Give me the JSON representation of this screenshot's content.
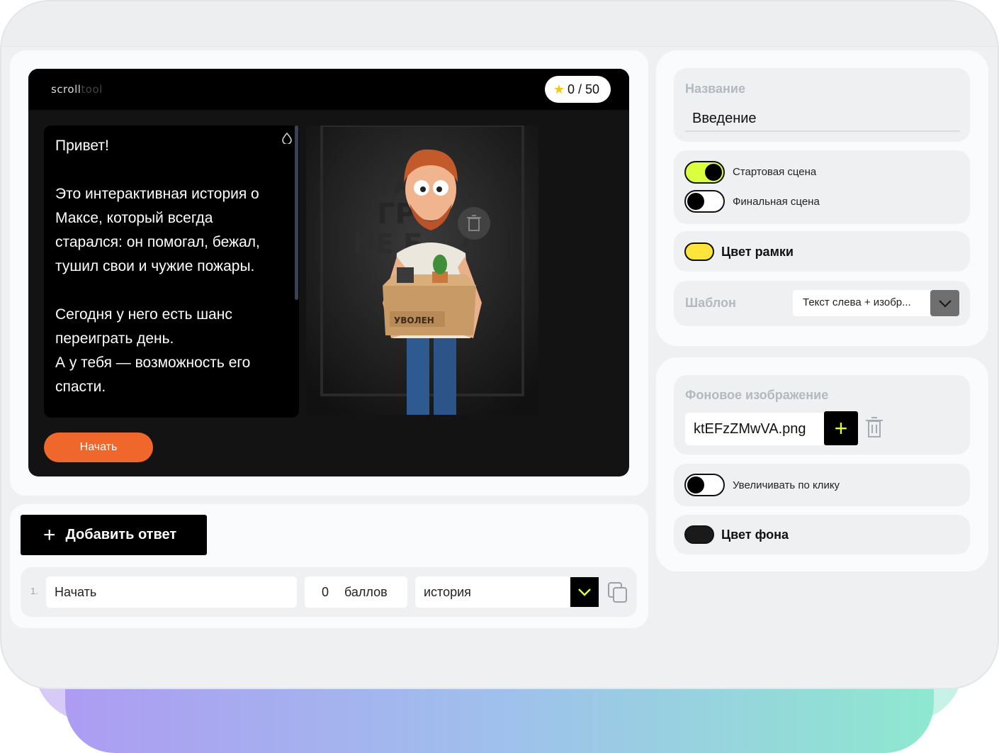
{
  "preview": {
    "logo_main": "scroll",
    "logo_dim": "tool",
    "score": "0 / 50",
    "text": "Привет!\n\nЭто интерактивная история о Максе, который всегда старался: он помогал, бежал, тушил свои и чужие пожары.\n\nСегодня у него есть шанс переиграть день.\nА у тебя — возможность его спасти.",
    "box_label": "УВОЛЕН",
    "wall_text": "ТАК\nГРУ\nНЕ БЫЛ Я",
    "start_button": "Начать"
  },
  "answers": {
    "add_button": "Добавить ответ",
    "rows": [
      {
        "number": "1.",
        "text": "Начать",
        "points": "0",
        "points_unit": "баллов",
        "target": "история"
      }
    ]
  },
  "settings": {
    "name_label": "Название",
    "name_value": "Введение",
    "start_scene_label": "Стартовая сцена",
    "final_scene_label": "Финальная сцена",
    "start_scene_on": true,
    "final_scene_on": false,
    "frame_color_label": "Цвет рамки",
    "frame_color": "#ffe53b",
    "template_label": "Шаблон",
    "template_value": "Текст слева + изобр..."
  },
  "background": {
    "label": "Фоновое изображение",
    "file_name": "ktEFzZMwVA.png",
    "zoom_label": "Увеличивать по клику",
    "zoom_on": false,
    "bg_color_label": "Цвет фона",
    "bg_color": "#1a1a1a"
  },
  "colors": {
    "accent_orange": "#f0672b",
    "accent_lime": "#d9ff3f"
  }
}
